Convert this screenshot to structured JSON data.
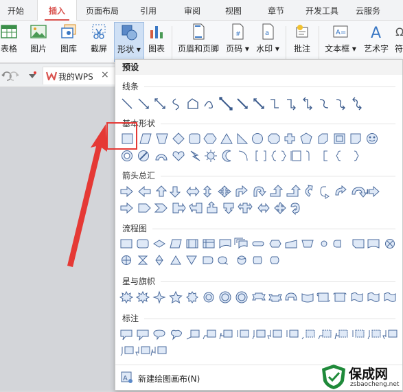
{
  "tabs": [
    "开始",
    "插入",
    "页面布局",
    "引用",
    "审阅",
    "视图",
    "章节",
    "开发工具",
    "云服务"
  ],
  "active_tab": "插入",
  "ribbon": {
    "table": "表格",
    "picture": "图片",
    "gallery": "图库",
    "screenshot": "截屏",
    "shapes": "形状",
    "chart": "图表",
    "header_footer": "页眉和页脚",
    "page_number": "页码",
    "watermark": "水印",
    "comment": "批注",
    "textbox": "文本框",
    "wordart": "艺术字",
    "cut_off": "符"
  },
  "docbar": {
    "tab_label": "我的WPS",
    "tab_close": "×"
  },
  "panel": {
    "title": "预设",
    "sections": [
      "线条",
      "基本形状",
      "箭头总汇",
      "流程图",
      "星与旗帜",
      "标注"
    ],
    "footer": "新建绘图画布(N)"
  },
  "watermark": {
    "brand": "保成网",
    "url": "zsbaocheng.net"
  },
  "colors": {
    "accent": "#d9534f",
    "annotation": "#e53935",
    "shape_stroke": "#4a6a9c",
    "shape_fill": "#dfe9f7"
  }
}
